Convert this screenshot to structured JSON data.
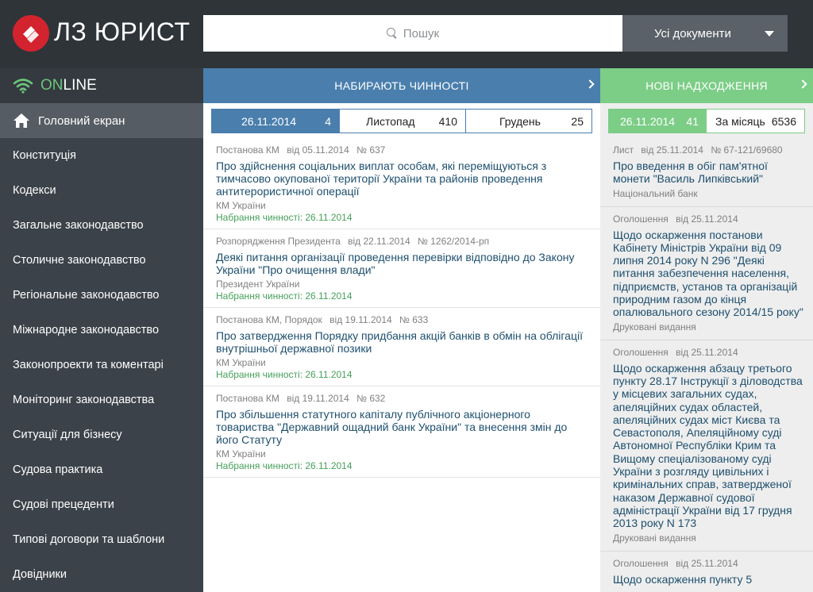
{
  "header": {
    "logo_text": "ЛЗ ЮРИСТ",
    "search_placeholder": "Пошук",
    "doc_filter": "Усі документи"
  },
  "sidebar": {
    "status_on": "ON",
    "status_line": "LINE",
    "items": [
      {
        "label": "Головний екран"
      },
      {
        "label": "Конституція"
      },
      {
        "label": "Кодекси"
      },
      {
        "label": "Загальне законодавство"
      },
      {
        "label": "Столичне законодавство"
      },
      {
        "label": "Регіональне законодавство"
      },
      {
        "label": "Міжнародне законодавство"
      },
      {
        "label": "Законопроекти та коментарі"
      },
      {
        "label": "Моніторинг законодавства"
      },
      {
        "label": "Ситуації для бізнесу"
      },
      {
        "label": "Судова практика"
      },
      {
        "label": "Судові прецеденти"
      },
      {
        "label": "Типові договори та шаблони"
      },
      {
        "label": "Довідники"
      }
    ]
  },
  "middle": {
    "heading": "НАБИРАЮТЬ ЧИННОСТІ",
    "tabs": [
      {
        "label": "26.11.2014",
        "count": "4"
      },
      {
        "label": "Листопад",
        "count": "410"
      },
      {
        "label": "Грудень",
        "count": "25"
      }
    ],
    "items": [
      {
        "type": "Постанова КМ",
        "date": "від 05.11.2014",
        "number": "№ 637",
        "title": "Про здійснення соціальних виплат особам, які переміщуються з тимчасово окупованої території України та районів проведення антитерористичної операції",
        "issuer": "КМ України",
        "effect": "Набрання чинності: 26.11.2014"
      },
      {
        "type": "Розпорядження Президента",
        "date": "від 22.11.2014",
        "number": "№ 1262/2014-рп",
        "title": "Деякі питання організації проведення перевірки відповідно до Закону України \"Про очищення влади\"",
        "issuer": "Президент України",
        "effect": "Набрання чинності: 26.11.2014"
      },
      {
        "type": "Постанова КМ, Порядок",
        "date": "від 19.11.2014",
        "number": "№ 633",
        "title": "Про затвердження Порядку придбання акцій банків в обмін на облігації внутрішньої державної позики",
        "issuer": "КМ України",
        "effect": "Набрання чинності: 26.11.2014"
      },
      {
        "type": "Постанова КМ",
        "date": "від 19.11.2014",
        "number": "№ 632",
        "title": "Про збільшення статутного капіталу публічного акціонерного товариства \"Державний ощадний банк України\" та внесення змін до його Статуту",
        "issuer": "КМ України",
        "effect": "Набрання чинності: 26.11.2014"
      }
    ]
  },
  "right": {
    "heading": "НОВІ НАДХОДЖЕННЯ",
    "tabs": [
      {
        "label": "26.11.2014",
        "count": "41"
      },
      {
        "label": "За місяць",
        "count": "6536"
      }
    ],
    "items": [
      {
        "type": "Лист",
        "date": "від 25.11.2014",
        "number": "№ 67-121/69680",
        "title": "Про введення в обіг пам'ятної монети \"Василь Липківський\"",
        "source": "Національний банк"
      },
      {
        "type": "Оголошення",
        "date": "від 25.11.2014",
        "number": "",
        "title": "Щодо оскарження постанови Кабінету Міністрів України від 09 липня 2014 року N 296 \"Деякі питання забезпечення населення, підприємств, установ та організацій природним газом до кінця опалювального сезону 2014/15 року\"",
        "source": "Друковані видання"
      },
      {
        "type": "Оголошення",
        "date": "від 25.11.2014",
        "number": "",
        "title": "Щодо оскарження абзацу третього пункту 28.17 Інструкції з діловодства у місцевих загальних судах, апеляційних судах областей, апеляційних судах міст Києва та Севастополя, Апеляційному суді Автономної Республіки Крим та Вищому спеціалізованому суді України з розгляду цивільних і кримінальних справ, затвердженої наказом Державної судової адміністрації України від 17 грудня 2013 року N 173",
        "source": "Друковані видання"
      },
      {
        "type": "Оголошення",
        "date": "від 25.11.2014",
        "number": "",
        "title": "Щодо оскарження пункту 5",
        "source": ""
      }
    ]
  },
  "colors": {
    "header_bg": "#2f3439",
    "sidebar_bg": "#3b4249",
    "blue_accent": "#4a7fad",
    "green_accent": "#7ccd86",
    "logo_red": "#d3232e",
    "link_text": "#1d4f6e",
    "effect_green": "#46a05a"
  }
}
